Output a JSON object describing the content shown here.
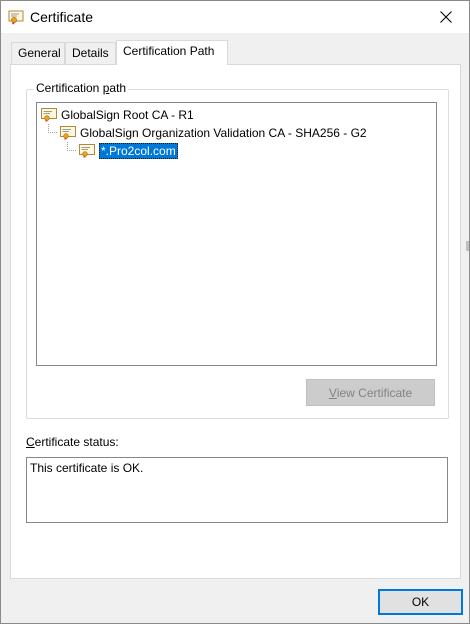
{
  "window": {
    "title": "Certificate",
    "icon": "certificate-icon",
    "close_icon": "close-icon"
  },
  "tabs": [
    {
      "label": "General",
      "active": false
    },
    {
      "label": "Details",
      "active": false
    },
    {
      "label": "Certification Path",
      "active": true
    }
  ],
  "path_group": {
    "label_prefix": "Certification ",
    "label_accel": "p",
    "label_suffix": "ath"
  },
  "tree": {
    "items": [
      {
        "label": "GlobalSign Root CA - R1",
        "level": 0,
        "selected": false,
        "icon": "certificate-icon"
      },
      {
        "label": "GlobalSign Organization Validation CA - SHA256 - G2",
        "level": 1,
        "selected": false,
        "icon": "certificate-icon"
      },
      {
        "label": "*.Pro2col.com",
        "level": 2,
        "selected": true,
        "icon": "certificate-icon"
      }
    ]
  },
  "buttons": {
    "view_certificate_accel": "V",
    "view_certificate_rest": "iew Certificate",
    "ok": "OK"
  },
  "status": {
    "label_accel": "C",
    "label_rest": "ertificate status:",
    "text": "This certificate is OK."
  },
  "colors": {
    "selection": "#0078d7",
    "window_bg": "#f0f0f0",
    "panel_bg": "#ffffff"
  }
}
